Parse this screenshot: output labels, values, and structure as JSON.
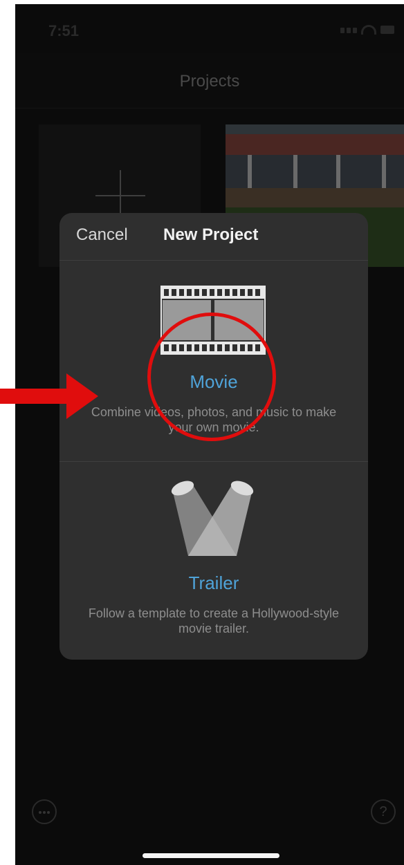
{
  "status_bar": {
    "time": "7:51"
  },
  "nav": {
    "title": "Projects"
  },
  "dialog": {
    "cancel_label": "Cancel",
    "title": "New Project",
    "options": [
      {
        "label": "Movie",
        "description": "Combine videos, photos, and music to make your own movie.",
        "icon": "film-strip-icon"
      },
      {
        "label": "Trailer",
        "description": "Follow a template to create a Hollywood-style movie trailer.",
        "icon": "spotlights-icon"
      }
    ]
  },
  "toolbar": {
    "more_icon": "ellipsis-icon",
    "help_label": "?"
  },
  "colors": {
    "accent": "#4fa3d9",
    "annotation": "#e00d0d",
    "dialog_bg": "#2f2f2f",
    "screen_bg": "#0b0b0b"
  }
}
